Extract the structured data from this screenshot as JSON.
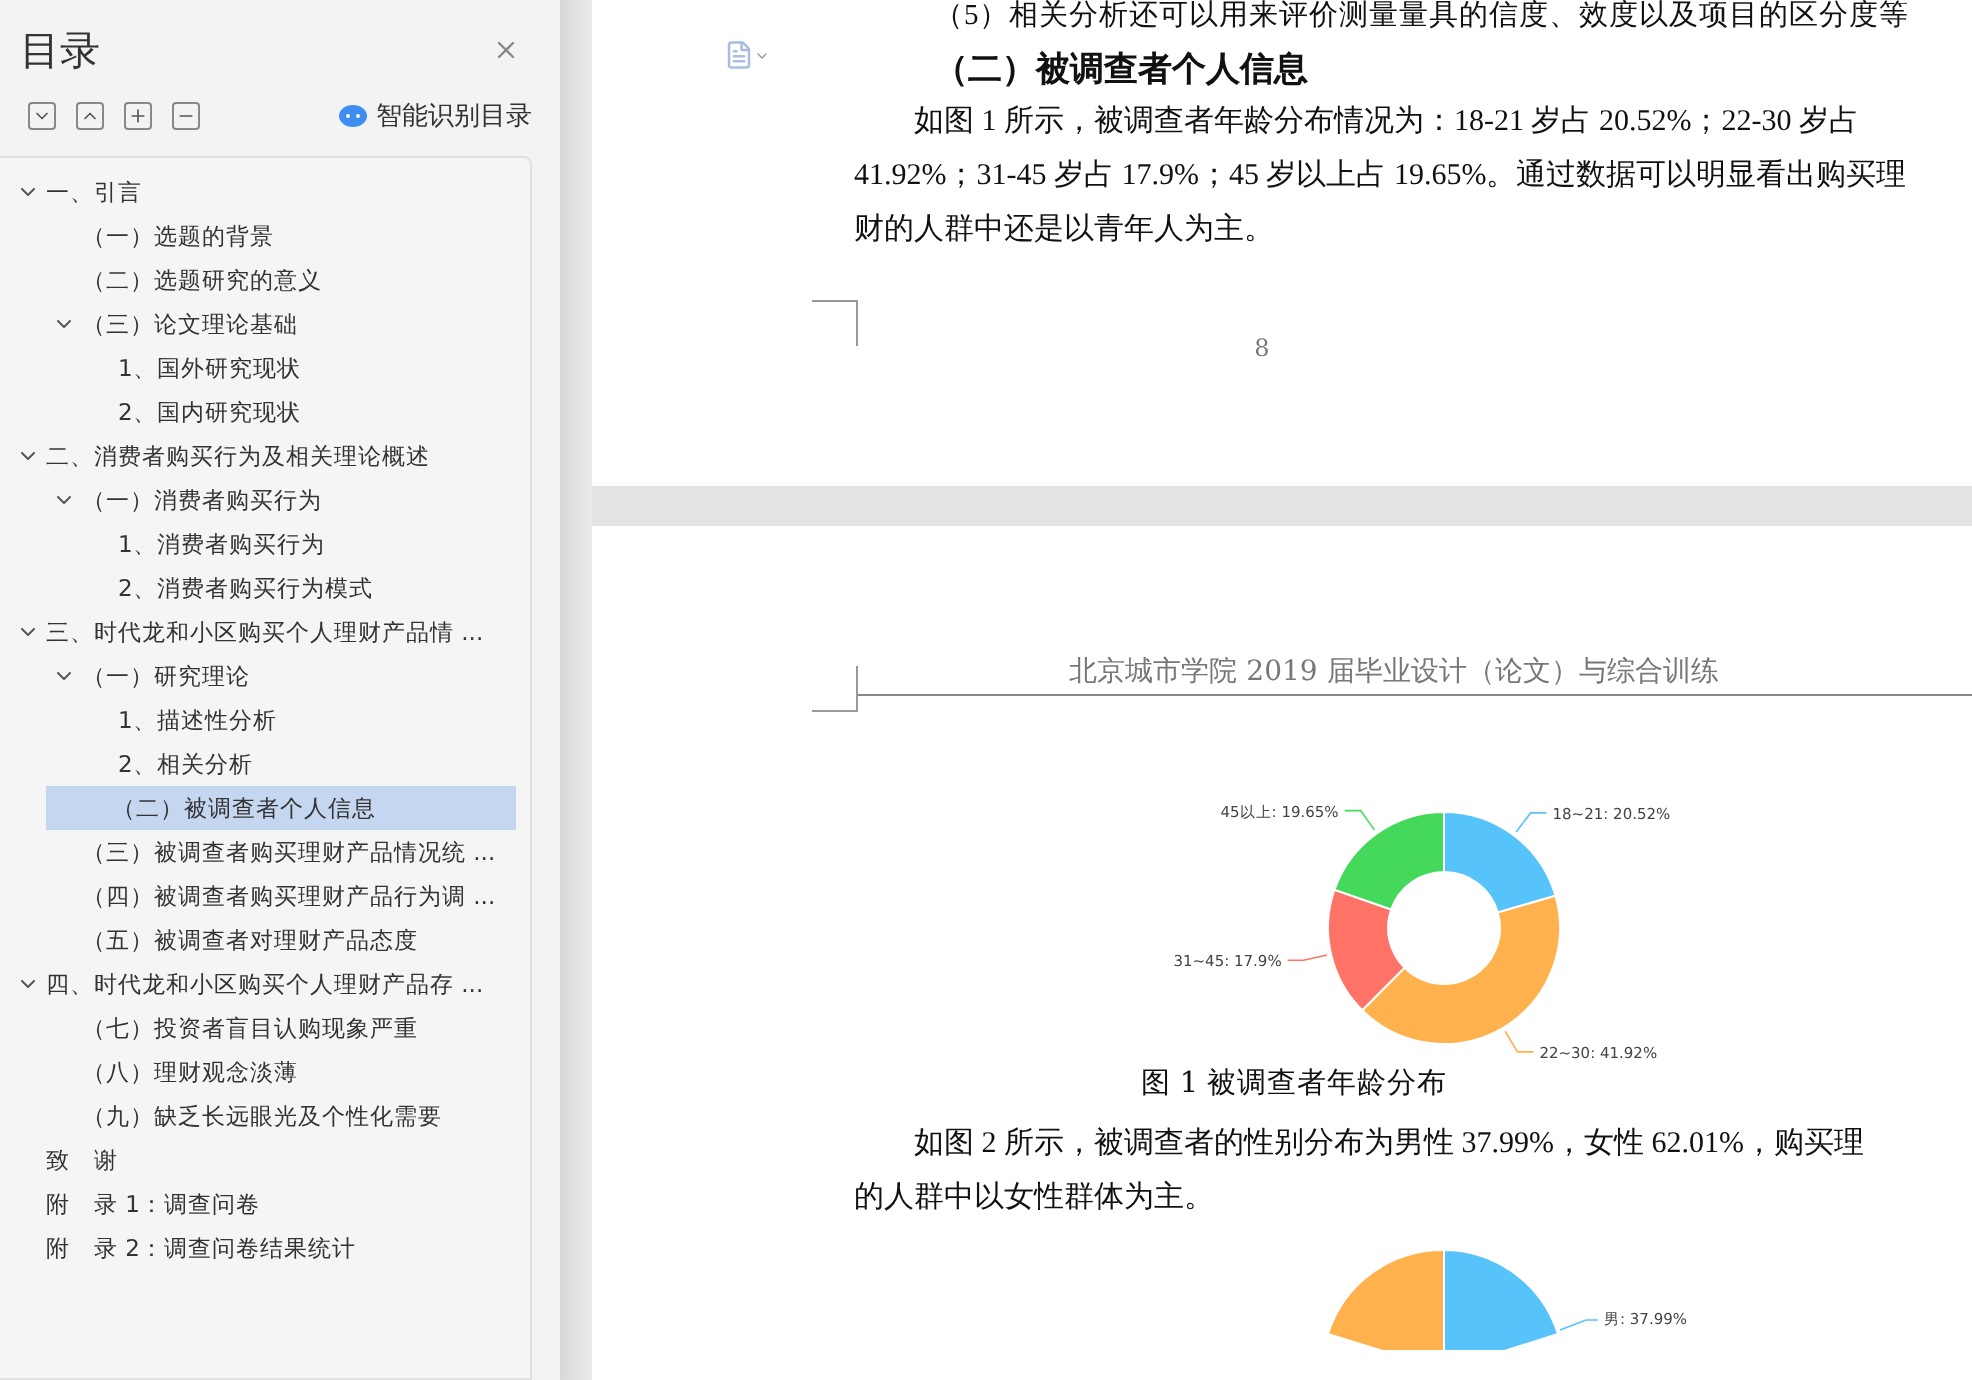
{
  "sidebar": {
    "title": "目录",
    "smart_button": "智能识别目录",
    "tree": [
      {
        "label": "一、引言",
        "selected": false,
        "expanded": true,
        "children": [
          {
            "label": "（一）选题的背景",
            "selected": false
          },
          {
            "label": "（二）选题研究的意义",
            "selected": false
          },
          {
            "label": "（三）论文理论基础",
            "selected": false,
            "expanded": true,
            "children": [
              {
                "label": "1、国外研究现状",
                "selected": false
              },
              {
                "label": "2、国内研究现状",
                "selected": false
              }
            ]
          }
        ]
      },
      {
        "label": "二、消费者购买行为及相关理论概述",
        "selected": false,
        "expanded": true,
        "children": [
          {
            "label": "（一）消费者购买行为",
            "selected": false,
            "expanded": true,
            "children": [
              {
                "label": "1、消费者购买行为",
                "selected": false
              },
              {
                "label": "2、消费者购买行为模式",
                "selected": false
              }
            ]
          }
        ]
      },
      {
        "label": "三、时代龙和小区购买个人理财产品情 ...",
        "selected": false,
        "expanded": true,
        "children": [
          {
            "label": "（一）研究理论",
            "selected": false,
            "expanded": true,
            "children": [
              {
                "label": "1、描述性分析",
                "selected": false
              },
              {
                "label": "2、相关分析",
                "selected": false
              }
            ]
          },
          {
            "label": "（二）被调查者个人信息",
            "selected": true
          },
          {
            "label": "（三）被调查者购买理财产品情况统 ...",
            "selected": false
          },
          {
            "label": "（四）被调查者购买理财产品行为调 ...",
            "selected": false
          },
          {
            "label": "（五）被调查者对理财产品态度",
            "selected": false
          }
        ]
      },
      {
        "label": "四、时代龙和小区购买个人理财产品存 ...",
        "selected": false,
        "expanded": true,
        "children": [
          {
            "label": "（七）投资者盲目认购现象严重",
            "selected": false
          },
          {
            "label": "（八）理财观念淡薄",
            "selected": false
          },
          {
            "label": "（九）缺乏长远眼光及个性化需要",
            "selected": false
          }
        ]
      },
      {
        "label": "致　谢",
        "selected": false
      },
      {
        "label": "附　录 1：调查问卷",
        "selected": false
      },
      {
        "label": "附　录 2：调查问卷结果统计",
        "selected": false
      }
    ]
  },
  "page_1": {
    "top_line": "（5）相关分析还可以用来评价测量量具的信度、效度以及项目的区分度等",
    "heading": "（二）被调查者个人信息",
    "paragraph_lines": [
      "如图 1 所示，被调查者年龄分布情况为：18-21 岁占 20.52%；22-30 岁占",
      "41.92%；31-45 岁占 17.9%；45 岁以上占 19.65%。通过数据可以明显看出购买理",
      "财的人群中还是以青年人为主。"
    ],
    "page_number": "8"
  },
  "page_2": {
    "header": "北京城市学院 2019 届毕业设计（论文）与综合训练",
    "chart_data": {
      "type": "donut",
      "values": [
        20.52,
        41.92,
        17.9,
        19.65
      ],
      "colors": [
        "#56c3fb",
        "#ffb14d",
        "#ff7366",
        "#45d95c"
      ],
      "value_labels": [
        "18~21: 20.52%",
        "22~30: 41.92%",
        "31~45: 17.9%",
        "45以上: 19.65%"
      ]
    },
    "caption": "图 1  被调查者年龄分布",
    "paragraph_lines": [
      "如图 2 所示，被调查者的性别分布为男性 37.99%，女性 62.01%，购买理",
      "的人群中以女性群体为主。"
    ],
    "pie_label": "男: 37.99%"
  }
}
